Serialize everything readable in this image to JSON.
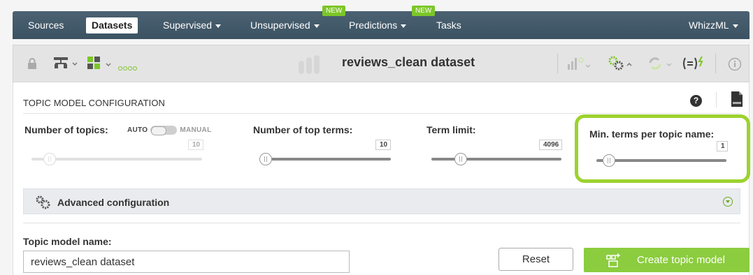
{
  "nav": {
    "items": [
      {
        "label": "Sources"
      },
      {
        "label": "Datasets"
      },
      {
        "label": "Supervised"
      },
      {
        "label": "Unsupervised"
      },
      {
        "label": "Predictions"
      },
      {
        "label": "Tasks"
      }
    ],
    "badges": [
      "NEW",
      "NEW"
    ],
    "right": "WhizzML"
  },
  "toolbar": {
    "title": "reviews_clean dataset"
  },
  "config": {
    "title": "TOPIC MODEL CONFIGURATION",
    "params": {
      "num_topics": {
        "label": "Number of topics:",
        "value": "10",
        "auto": "AUTO",
        "manual": "MANUAL"
      },
      "top_terms": {
        "label": "Number of top terms:",
        "value": "10"
      },
      "term_limit": {
        "label": "Term limit:",
        "value": "4096"
      },
      "min_terms": {
        "label": "Min. terms per topic name:",
        "value": "1"
      }
    },
    "advanced": "Advanced configuration"
  },
  "form": {
    "name_label": "Topic model name:",
    "name_value": "reviews_clean dataset",
    "reset": "Reset",
    "create": "Create topic model"
  },
  "colors": {
    "nav_bg": "#3f5666",
    "accent": "#8ccc3f",
    "highlight": "#9dd22f"
  }
}
